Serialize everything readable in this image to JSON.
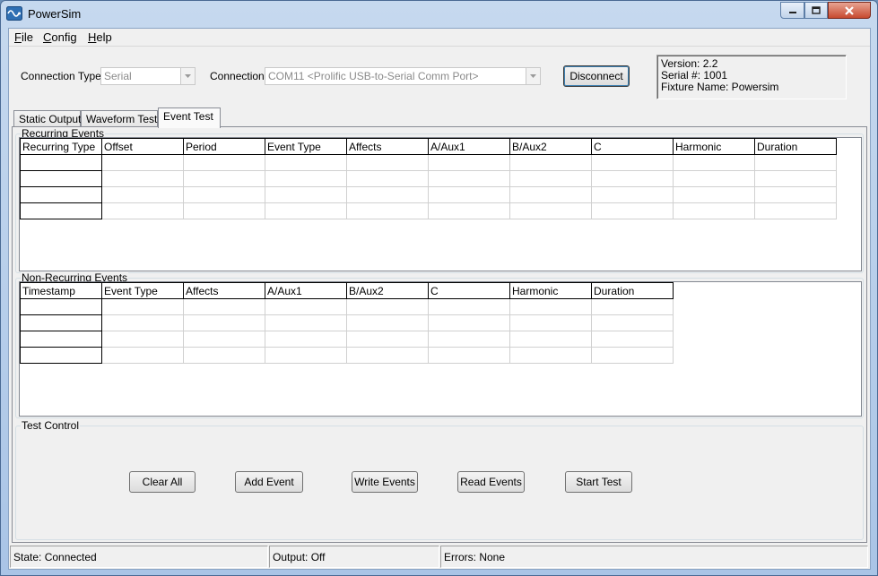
{
  "window": {
    "title": "PowerSim"
  },
  "menu": [
    {
      "label": "File",
      "mnemonic": "F",
      "rest": "ile"
    },
    {
      "label": "Config",
      "mnemonic": "C",
      "rest": "onfig"
    },
    {
      "label": "Help",
      "mnemonic": "H",
      "rest": "elp"
    }
  ],
  "connection": {
    "type_label": "Connection Type",
    "type_value": "Serial",
    "conn_label": "Connection",
    "conn_value": "COM11 <Prolific USB-to-Serial Comm Port>",
    "disconnect_label": "Disconnect"
  },
  "info": {
    "version": "Version: 2.2",
    "serial": "Serial #: 1001",
    "fixture": "Fixture Name: Powersim"
  },
  "tabs": [
    {
      "label": "Static Output",
      "active": false
    },
    {
      "label": "Waveform Test",
      "active": false
    },
    {
      "label": "Event Test",
      "active": true
    }
  ],
  "recurring": {
    "title": "Recurring Events",
    "columns": [
      "Recurring Type",
      "Offset",
      "Period",
      "Event Type",
      "Affects",
      "A/Aux1",
      "B/Aux2",
      "C",
      "Harmonic",
      "Duration"
    ],
    "row_count": 4
  },
  "nonrecurring": {
    "title": "Non-Recurring Events",
    "columns": [
      "Timestamp",
      "Event Type",
      "Affects",
      "A/Aux1",
      "B/Aux2",
      "C",
      "Harmonic",
      "Duration"
    ],
    "row_count": 4
  },
  "test_control": {
    "title": "Test Control",
    "buttons": [
      "Clear All",
      "Add Event",
      "Write Events",
      "Read Events",
      "Start Test"
    ]
  },
  "status": {
    "state": "State: Connected",
    "output": "Output: Off",
    "errors": "Errors: None"
  }
}
